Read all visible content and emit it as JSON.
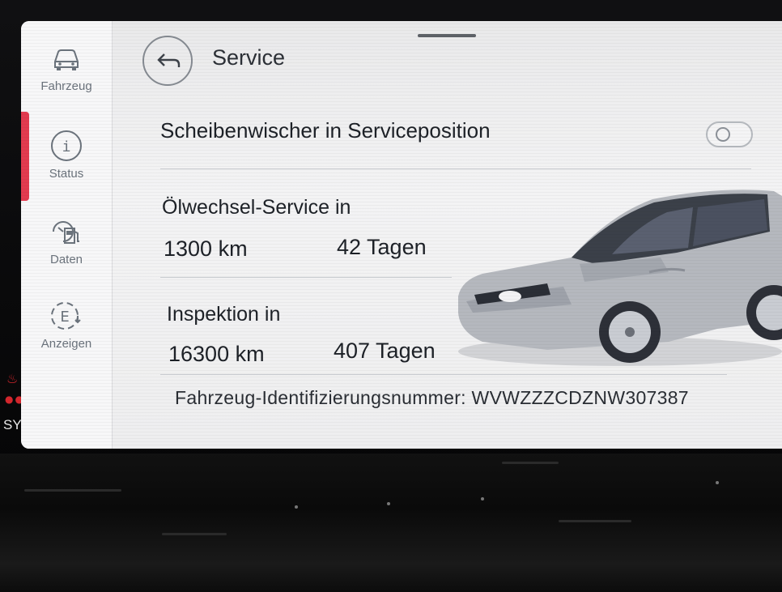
{
  "sidebar": {
    "items": [
      {
        "label": "Fahrzeug",
        "icon": "car-icon"
      },
      {
        "label": "Status",
        "icon": "info-icon"
      },
      {
        "label": "Daten",
        "icon": "trip-data-icon"
      },
      {
        "label": "Anzeigen",
        "icon": "display-icon"
      }
    ],
    "active_color": "#e23b4f"
  },
  "header": {
    "title": "Service",
    "back_icon": "back-arrow-icon"
  },
  "settings": {
    "wiper_service_label": "Scheibenwischer in Serviceposition",
    "wiper_service_enabled": false
  },
  "oil_service": {
    "title": "Ölwechsel-Service in",
    "distance": "1300 km",
    "days": "42 Tagen"
  },
  "inspection": {
    "title": "Inspektion in",
    "distance": "16300 km",
    "days": "407 Tagen"
  },
  "vin": {
    "text": "Fahrzeug-Identifizierungsnummer: WVWZZZCDZNW307387"
  },
  "bezel": {
    "sync_label": "SYNC",
    "heat_icon": "rear-defrost-icon"
  }
}
